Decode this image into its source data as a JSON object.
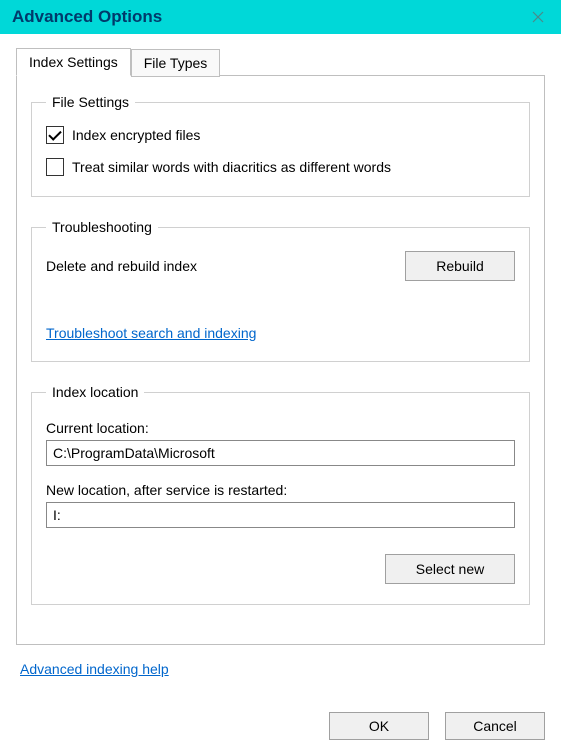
{
  "titlebar": {
    "title": "Advanced Options"
  },
  "tabs": {
    "index_settings": "Index Settings",
    "file_types": "File Types"
  },
  "file_settings": {
    "legend": "File Settings",
    "index_encrypted": "Index encrypted files",
    "diacritics": "Treat similar words with diacritics as different words"
  },
  "troubleshooting": {
    "legend": "Troubleshooting",
    "delete_rebuild": "Delete and rebuild index",
    "rebuild_button": "Rebuild",
    "troubleshoot_link": "Troubleshoot search and indexing"
  },
  "index_location": {
    "legend": "Index location",
    "current_label": "Current location:",
    "current_value": "C:\\ProgramData\\Microsoft",
    "new_label": "New location, after service is restarted:",
    "new_value": "I:",
    "select_new": "Select new"
  },
  "help_link": "Advanced indexing help",
  "buttons": {
    "ok": "OK",
    "cancel": "Cancel"
  }
}
